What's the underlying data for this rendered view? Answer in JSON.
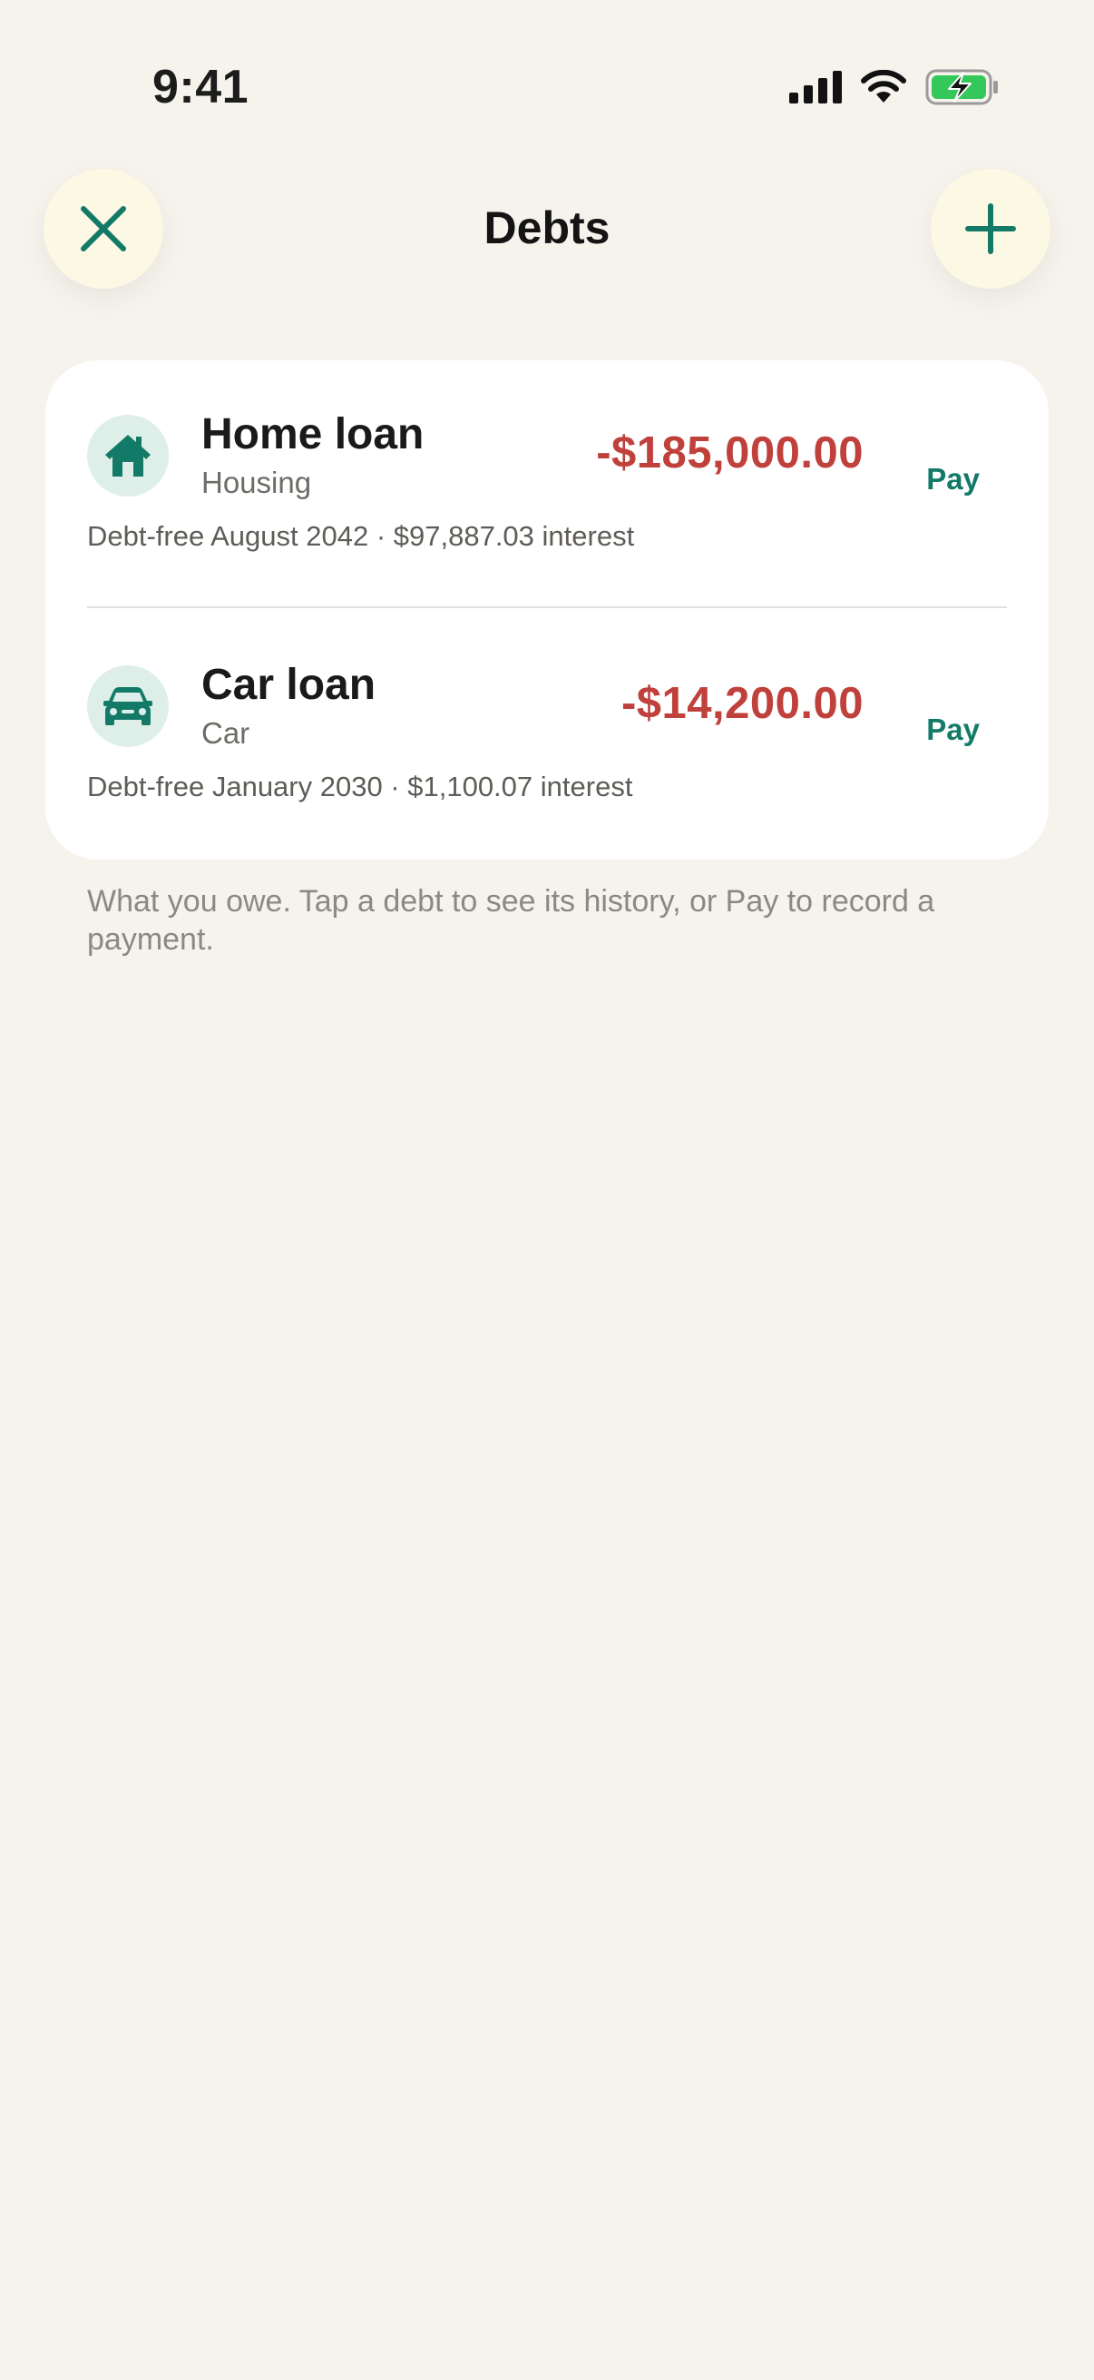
{
  "status_bar": {
    "time": "9:41",
    "icons": [
      "cellular-signal-icon",
      "wifi-icon",
      "battery-charging-icon"
    ]
  },
  "nav": {
    "title": "Debts",
    "close_icon": "close-icon",
    "add_icon": "plus-icon"
  },
  "debts": [
    {
      "name": "Home loan",
      "category": "Housing",
      "icon": "house-icon",
      "amount": "-$185,000.00",
      "pay_label": "Pay",
      "summary": "Debt-free August 2042 · $97,887.03 interest"
    },
    {
      "name": "Car loan",
      "category": "Car",
      "icon": "car-icon",
      "amount": "-$14,200.00",
      "pay_label": "Pay",
      "summary": "Debt-free January 2030 · $1,100.07 interest"
    }
  ],
  "footnote": "What you owe. Tap a debt to see its history, or Pay to record a payment.",
  "colors": {
    "background": "#f6f3ec",
    "accent": "#137a68",
    "negative": "#c0413c",
    "button_bg": "#fbf8e4",
    "battery": "#34c759"
  }
}
